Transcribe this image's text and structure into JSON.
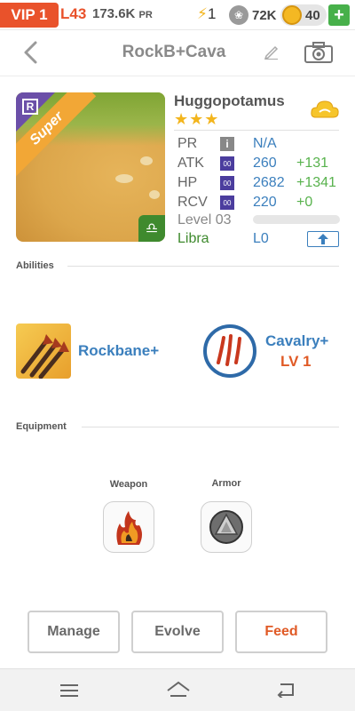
{
  "topbar": {
    "vip": "VIP 1",
    "level": "L43",
    "power": "173.6K",
    "power_unit": "PR",
    "energy": "1",
    "paw_count": "72K",
    "coins": "40",
    "plus": "+"
  },
  "header": {
    "title": "RockB+Cava"
  },
  "card": {
    "rarity_badge": "R",
    "tier": "Super"
  },
  "monster": {
    "name": "Huggopotamus",
    "stars": "★★★",
    "stats": [
      {
        "label": "PR",
        "value": "N/A",
        "bonus": "",
        "icon": "i"
      },
      {
        "label": "ATK",
        "value": "260",
        "bonus": "+131",
        "icon": "00"
      },
      {
        "label": "HP",
        "value": "2682",
        "bonus": "+1341",
        "icon": "00"
      },
      {
        "label": "RCV",
        "value": "220",
        "bonus": "+0",
        "icon": "00"
      }
    ],
    "level": "Level 03",
    "level_progress": 0,
    "sign": "Libra",
    "sign_level": "L0"
  },
  "sections": {
    "abilities": "Abilities",
    "equipment": "Equipment"
  },
  "abilities": [
    {
      "name": "Rockbane+",
      "level": ""
    },
    {
      "name": "Cavalry+",
      "level": "LV 1"
    }
  ],
  "equipment": {
    "weapon_label": "Weapon",
    "armor_label": "Armor"
  },
  "actions": {
    "manage": "Manage",
    "evolve": "Evolve",
    "feed": "Feed"
  },
  "colors": {
    "accent": "#e9522b",
    "link_blue": "#3b7fbd",
    "bonus_green": "#58b24d",
    "feed_orange": "#e05a26"
  }
}
